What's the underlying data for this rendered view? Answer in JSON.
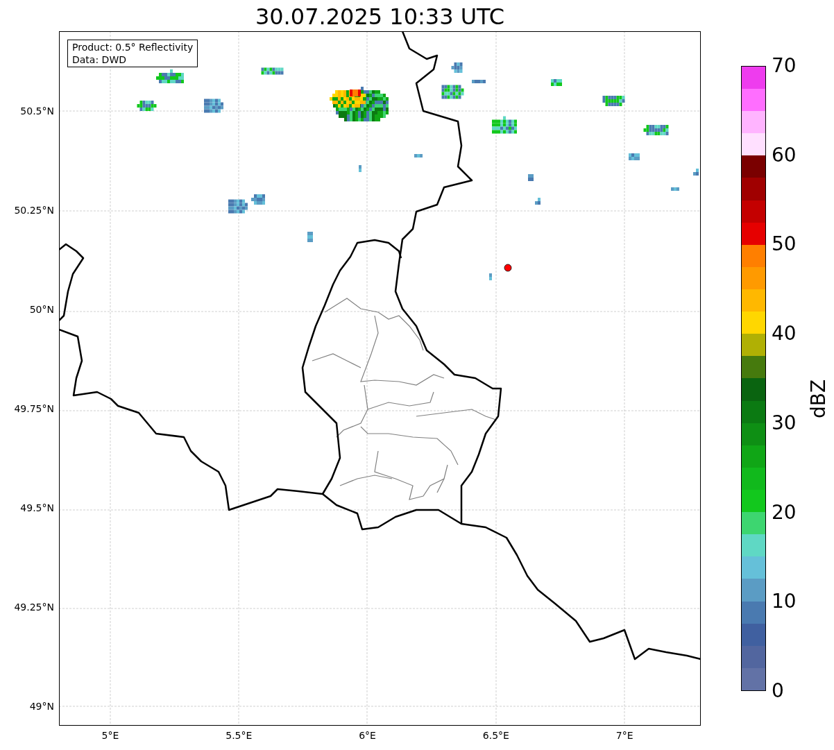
{
  "title": "30.07.2025 10:33 UTC",
  "info_box": [
    "Product: 0.5° Reflectivity",
    "Data: DWD"
  ],
  "lat_ticks": [
    "50.5°N",
    "50.25°N",
    "50°N",
    "49.75°N",
    "49.5°N",
    "49.25°N",
    "49°N"
  ],
  "lon_ticks": [
    "5°E",
    "5.5°E",
    "6°E",
    "6.5°E",
    "7°E"
  ],
  "colorbar": {
    "label": "dBZ",
    "ticks": [
      "70",
      "60",
      "50",
      "40",
      "30",
      "20",
      "10",
      "0"
    ],
    "bins": [
      {
        "color": "#6272a6"
      },
      {
        "color": "#52669f"
      },
      {
        "color": "#4060a0"
      },
      {
        "color": "#4a7ab0"
      },
      {
        "color": "#5b9cc4"
      },
      {
        "color": "#65c0d9"
      },
      {
        "color": "#5fd8c4"
      },
      {
        "color": "#3dd670"
      },
      {
        "color": "#12c81d"
      },
      {
        "color": "#11b91c"
      },
      {
        "color": "#10a616"
      },
      {
        "color": "#0e8f14"
      },
      {
        "color": "#0b7a12"
      },
      {
        "color": "#0a6410"
      },
      {
        "color": "#467a0d"
      },
      {
        "color": "#b0b004"
      },
      {
        "color": "#ffd700"
      },
      {
        "color": "#ffb800"
      },
      {
        "color": "#ff9a00"
      },
      {
        "color": "#ff7f00"
      },
      {
        "color": "#e60000"
      },
      {
        "color": "#c40000"
      },
      {
        "color": "#a00000"
      },
      {
        "color": "#7a0000"
      },
      {
        "color": "#ffe0ff"
      },
      {
        "color": "#ffb4ff"
      },
      {
        "color": "#ff6eff"
      },
      {
        "color": "#ee3cee"
      }
    ]
  }
}
